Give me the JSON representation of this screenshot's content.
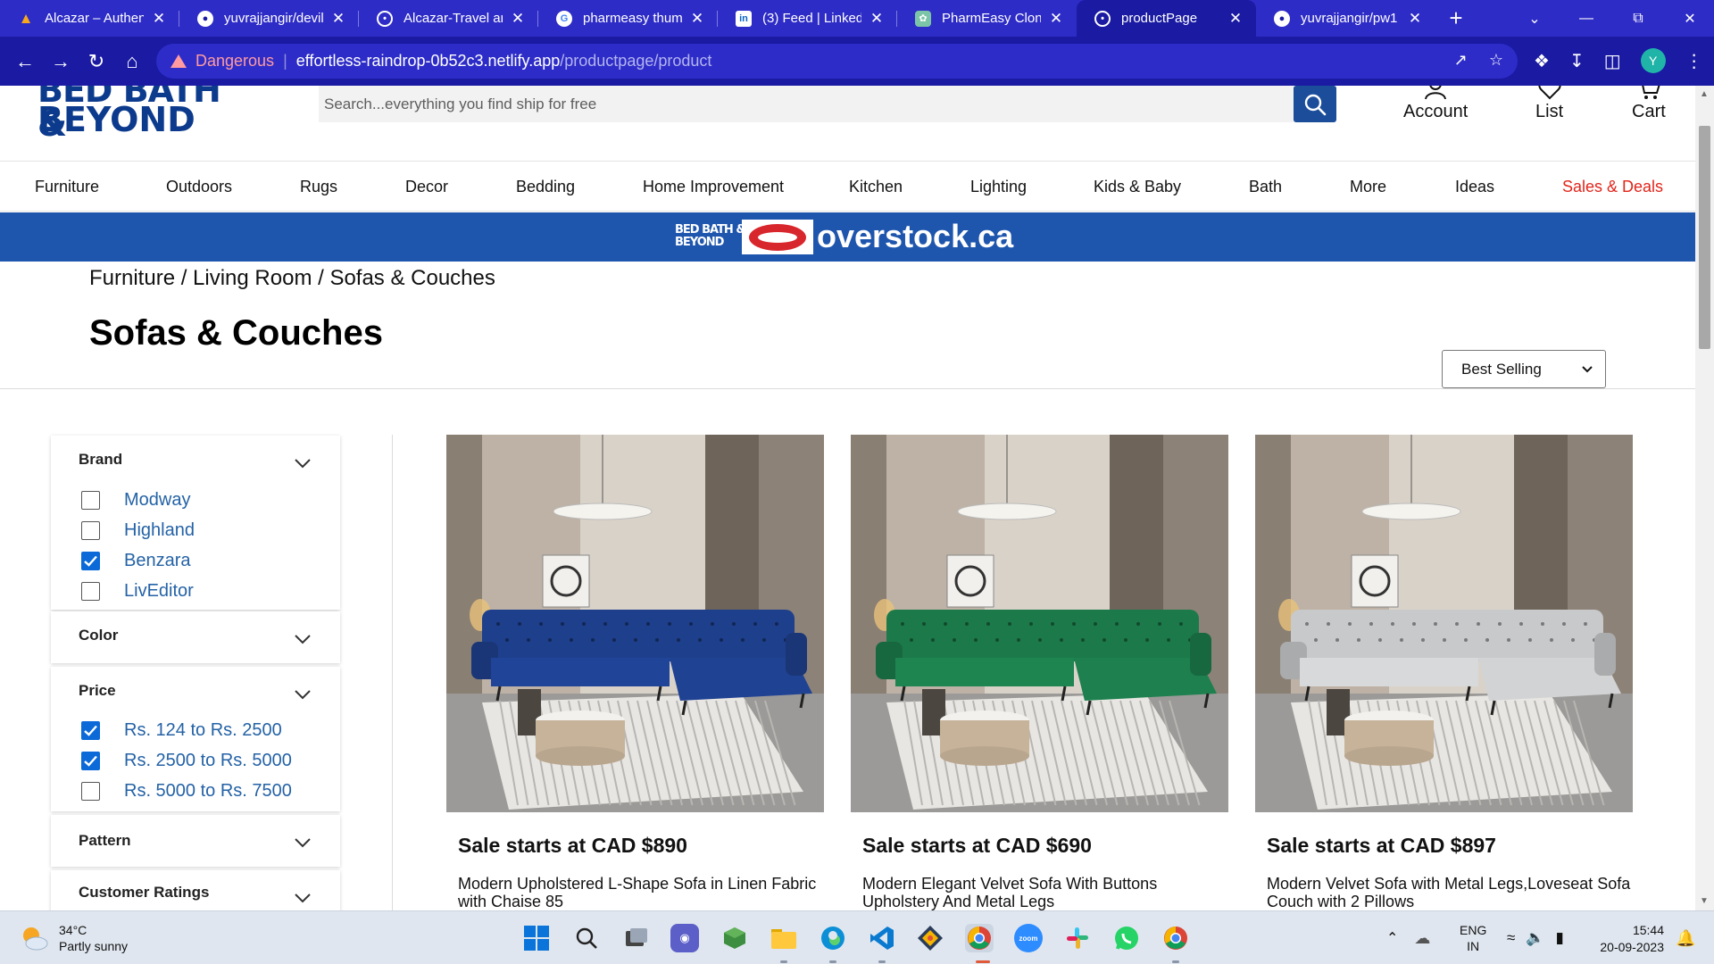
{
  "browser": {
    "tabs": [
      {
        "title": "Alcazar – Authent",
        "icon": "flame-icon",
        "active": false
      },
      {
        "title": "yuvrajjangir/devil",
        "icon": "github-icon",
        "active": false
      },
      {
        "title": "Alcazar-Travel arc",
        "icon": "globe-icon",
        "active": false
      },
      {
        "title": "pharmeasy thumt",
        "icon": "google-icon",
        "active": false
      },
      {
        "title": "(3) Feed | Linkedl",
        "icon": "linkedin-icon",
        "active": false
      },
      {
        "title": "PharmEasy Clone",
        "icon": "openai-icon",
        "active": false
      },
      {
        "title": "productPage",
        "icon": "globe-icon",
        "active": true
      },
      {
        "title": "yuvrajjangir/pw1",
        "icon": "github-icon",
        "active": false
      }
    ],
    "new_tab": "+",
    "security_label": "Dangerous",
    "url_host": "effortless-raindrop-0b52c3.netlify.app",
    "url_path": "/productpage/product",
    "profile_initial": "Y"
  },
  "site": {
    "logo_line1": "BED BATH &",
    "logo_line2": "BEYOND",
    "search_placeholder": "Search...everything you find ship for free",
    "account_label": "Account",
    "list_label": "List",
    "cart_label": "Cart",
    "categories": [
      "Furniture",
      "Outdoors",
      "Rugs",
      "Decor",
      "Bedding",
      "Home Improvement",
      "Kitchen",
      "Lighting",
      "Kids & Baby",
      "Bath",
      "More",
      "Ideas",
      "Sales & Deals"
    ],
    "banner_bbb_line1": "BED BATH &",
    "banner_bbb_line2": "BEYOND",
    "banner_text": "overstock.ca",
    "breadcrumb": "Furniture / Living Room / Sofas & Couches",
    "page_title": "Sofas & Couches",
    "sort_selected": "Best Selling"
  },
  "filters": {
    "brand": {
      "title": "Brand",
      "options": [
        {
          "label": "Modway",
          "checked": false
        },
        {
          "label": "Highland",
          "checked": false
        },
        {
          "label": "Benzara",
          "checked": true
        },
        {
          "label": "LivEditor",
          "checked": false
        }
      ]
    },
    "color": {
      "title": "Color"
    },
    "price": {
      "title": "Price",
      "options": [
        {
          "label": "Rs. 124 to Rs. 2500",
          "checked": true
        },
        {
          "label": "Rs. 2500 to Rs. 5000",
          "checked": true
        },
        {
          "label": "Rs. 5000 to Rs. 7500",
          "checked": false
        }
      ]
    },
    "pattern": {
      "title": "Pattern"
    },
    "ratings": {
      "title": "Customer Ratings"
    }
  },
  "products": [
    {
      "price": "Sale starts at CAD $890",
      "name": "Modern Upholstered L-Shape Sofa in Linen Fabric with Chaise 85",
      "sofa_color": "#1e3f8c"
    },
    {
      "price": "Sale starts at CAD $690",
      "name": "Modern Elegant Velvet Sofa With Buttons Upholstery And Metal Legs",
      "sofa_color": "#1c7a4a"
    },
    {
      "price": "Sale starts at CAD $897",
      "name": "Modern Velvet Sofa with Metal Legs,Loveseat Sofa Couch with 2 Pillows",
      "sofa_color": "#c8c9cb"
    }
  ],
  "taskbar": {
    "temperature": "34°C",
    "weather": "Partly sunny",
    "lang_line1": "ENG",
    "lang_line2": "IN",
    "time": "15:44",
    "date": "20-09-2023"
  }
}
